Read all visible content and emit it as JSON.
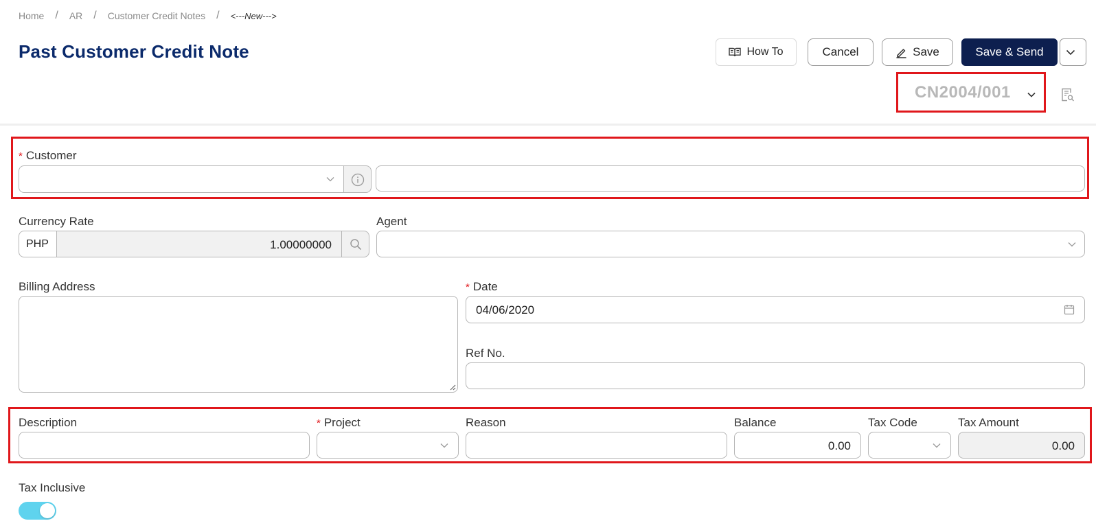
{
  "breadcrumb": {
    "home": "Home",
    "ar": "AR",
    "section": "Customer Credit Notes",
    "current": "<---New--->"
  },
  "title": "Past Customer Credit Note",
  "toolbar": {
    "how_to": "How To",
    "cancel": "Cancel",
    "save": "Save",
    "save_send": "Save & Send"
  },
  "document": {
    "number": "CN2004/001"
  },
  "form": {
    "customer": {
      "label": "Customer",
      "code_value": "",
      "name_value": ""
    },
    "currency_rate": {
      "label": "Currency Rate",
      "currency": "PHP",
      "value": "1.00000000"
    },
    "agent": {
      "label": "Agent",
      "value": ""
    },
    "billing_address": {
      "label": "Billing Address",
      "value": ""
    },
    "date": {
      "label": "Date",
      "value": "04/06/2020"
    },
    "ref_no": {
      "label": "Ref No.",
      "value": ""
    },
    "line": {
      "description": {
        "label": "Description",
        "value": ""
      },
      "project": {
        "label": "Project",
        "value": ""
      },
      "reason": {
        "label": "Reason",
        "value": ""
      },
      "balance": {
        "label": "Balance",
        "value": "0.00"
      },
      "tax_code": {
        "label": "Tax Code",
        "value": ""
      },
      "tax_amount": {
        "label": "Tax Amount",
        "value": "0.00"
      }
    },
    "tax_inclusive": {
      "label": "Tax Inclusive",
      "enabled": true
    }
  },
  "colors": {
    "accent_navy": "#0d1f4f",
    "title_blue": "#0b2a6b",
    "highlight_red": "#e0171b",
    "toggle_on": "#5fd3ee",
    "required": "#e0171b"
  }
}
